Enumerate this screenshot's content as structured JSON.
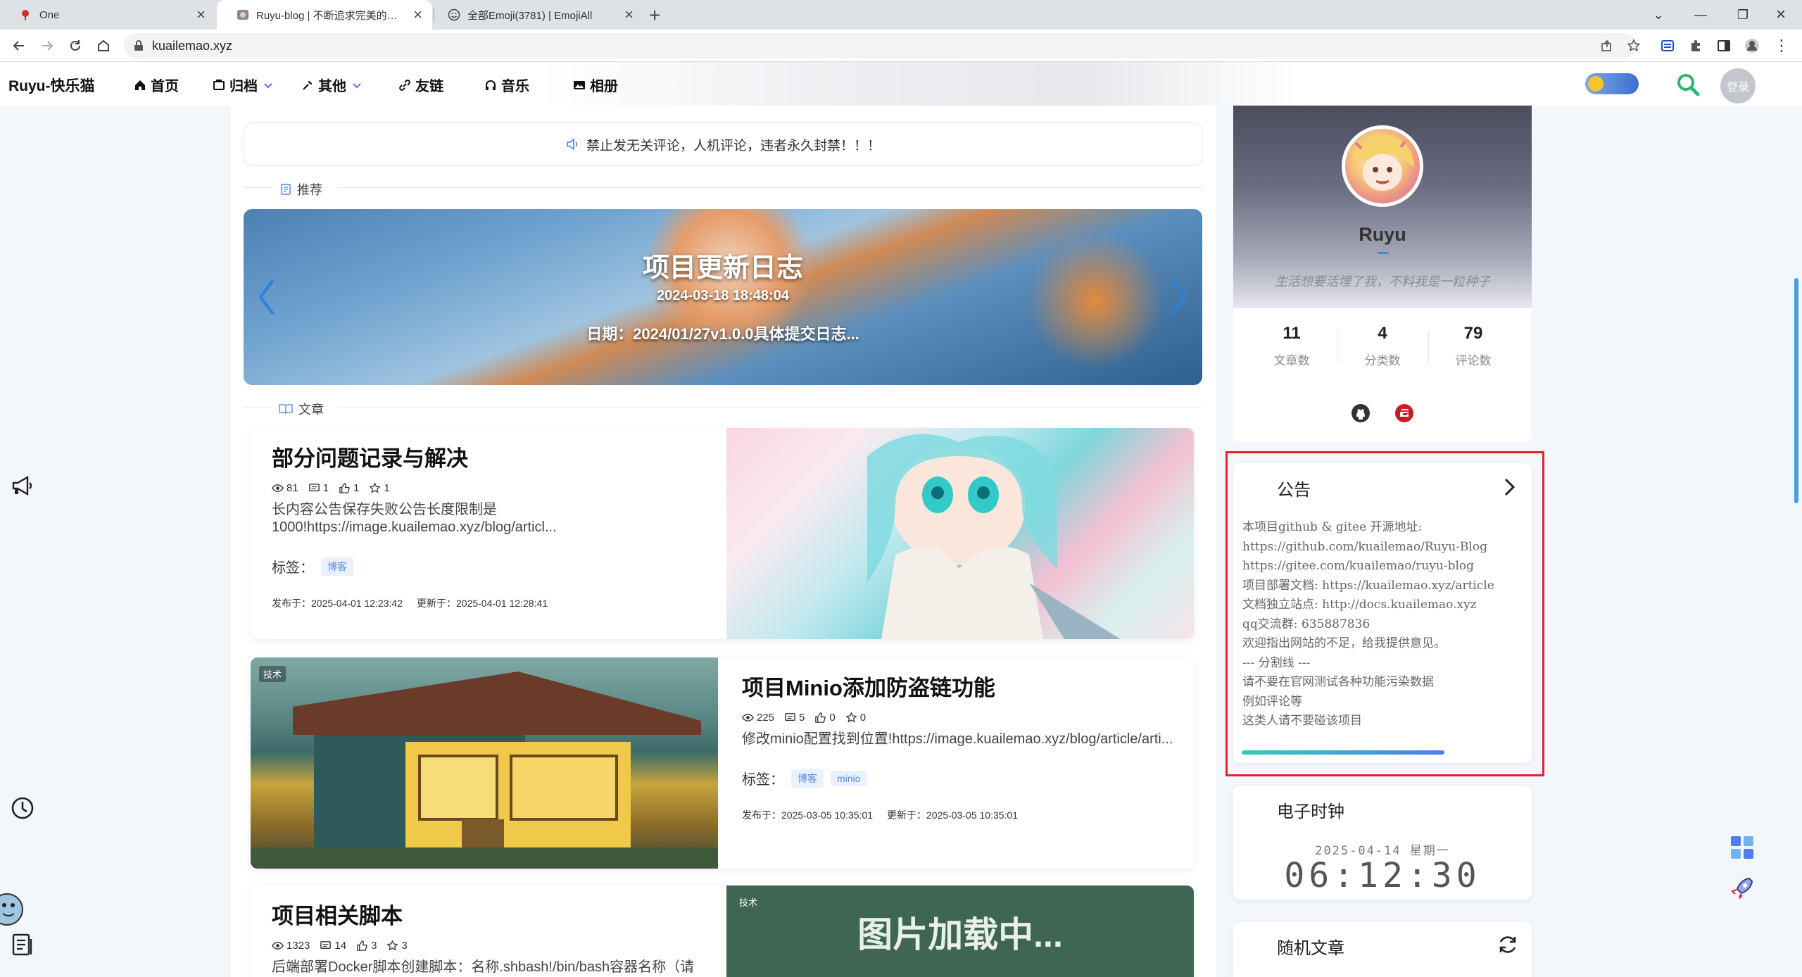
{
  "browser": {
    "tabs": [
      {
        "title": "One",
        "icon": "pin-icon"
      },
      {
        "title": "Ruyu-blog | 不断追求完美的开发者",
        "icon": "blog-favicon"
      },
      {
        "title": "全部Emoji(3781) | EmojiAll",
        "icon": "smiley-icon"
      }
    ],
    "url": "kuailemao.xyz"
  },
  "nav": {
    "brand": "Ruyu-快乐猫",
    "items": [
      "首页",
      "归档",
      "其他",
      "友链",
      "音乐",
      "相册"
    ],
    "login": "登录"
  },
  "notice": "禁止发无关评论，人机评论，违者永久封禁！！！",
  "sections": {
    "recommend": "推荐",
    "articles": "文章"
  },
  "carousel": {
    "title": "项目更新日志",
    "date": "2024-03-18 18:48:04",
    "desc": "日期：2024/01/27v1.0.0具体提交日志..."
  },
  "articles": [
    {
      "title": "部分问题记录与解决",
      "views": "81",
      "comments": "1",
      "likes": "1",
      "favorites": "1",
      "desc": "长内容公告保存失败公告长度限制是1000!https://image.kuailemao.xyz/blog/articl...",
      "tags_label": "标签：",
      "tags": [
        "博客"
      ],
      "published": "发布于：2025-04-01 12:23:42",
      "updated": "更新于：2025-04-01 12:28:41"
    },
    {
      "badge": "技术",
      "title": "项目Minio添加防盗链功能",
      "views": "225",
      "comments": "5",
      "likes": "0",
      "favorites": "0",
      "desc": "修改minio配置找到位置!https://image.kuailemao.xyz/blog/article/arti...",
      "tags_label": "标签：",
      "tags": [
        "博客",
        "minio"
      ],
      "published": "发布于：2025-03-05 10:35:01",
      "updated": "更新于：2025-03-05 10:35:01"
    },
    {
      "badge": "技术",
      "title": "项目相关脚本",
      "views": "1323",
      "comments": "14",
      "likes": "3",
      "favorites": "3",
      "desc": "后端部署Docker脚本创建脚本：名称.shbash!/bin/bash容器名称（请替换为你的容器名称）CONTAINE...",
      "image_loading": "图片加载中..."
    }
  ],
  "profile": {
    "name": "Ruyu",
    "motto": "生活想要活埋了我，不料我是一粒种子",
    "stats": [
      {
        "value": "11",
        "label": "文章数"
      },
      {
        "value": "4",
        "label": "分类数"
      },
      {
        "value": "79",
        "label": "评论数"
      }
    ]
  },
  "announcement": {
    "title": "公告",
    "lines": [
      "本项目github & gitee 开源地址:",
      "https://github.com/kuailemao/Ruyu-Blog",
      "https://gitee.com/kuailemao/ruyu-blog",
      "项目部署文档: https://kuailemao.xyz/article",
      "文档独立站点: http://docs.kuailemao.xyz",
      "qq交流群: 635887836",
      "欢迎指出网站的不足，给我提供意见。",
      "--- 分割线 ---",
      "请不要在官网测试各种功能污染数据",
      "例如评论等",
      "这类人请不要碰该项目"
    ],
    "progress": 0.72
  },
  "clock": {
    "title": "电子时钟",
    "date": "2025-04-14 星期一",
    "time": "06:12:30"
  },
  "random": {
    "title": "随机文章"
  },
  "colors": {
    "accent": "#4e7ef0",
    "highlight_border": "#e3242b",
    "tag_text": "#5b8dd6"
  }
}
